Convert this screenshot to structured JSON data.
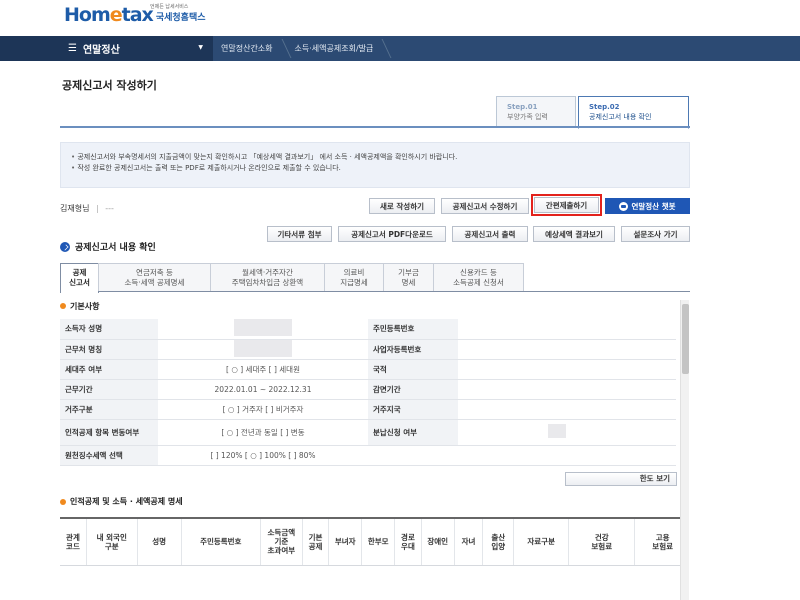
{
  "header": {
    "logo_small": "언제든 납세서비스",
    "logo_home": "Hom",
    "logo_e": "e",
    "logo_tax": "tax",
    "logo_agency": "국세청홈택스"
  },
  "nav": {
    "menu_label": "연말정산",
    "breadcrumbs": [
      "연말정산간소화",
      "소득·세액공제조회/발급"
    ]
  },
  "page": {
    "title": "공제신고서 작성하기"
  },
  "steps": [
    {
      "num": "Step.01",
      "label": "부양가족 입력"
    },
    {
      "num": "Step.02",
      "label": "공제신고서 내용 확인"
    }
  ],
  "notice": [
    "공제신고서와 부속명세서의 지출금액이 맞는지 확인하시고 「예상세액 결과보기」 에서 소득 · 세액공제액을 확인하시기 바랍니다.",
    "작성 완료한 공제신고서는 출력 또는 PDF로 제출하시거나 온라인으로 제출할 수 있습니다."
  ],
  "user": {
    "name": "김재형님",
    "sep": "|",
    "dashes": "---"
  },
  "buttons": {
    "new": "새로 작성하기",
    "edit": "공제신고서 수정하기",
    "submit": "간편제출하기",
    "chatbot": "연말정산 챗봇",
    "attach": "기타서류 첨부",
    "pdf": "공제신고서 PDF다운로드",
    "print": "공제신고서 출력",
    "result": "예상세액 결과보기",
    "survey": "설문조사 가기",
    "detail": "한도 보기"
  },
  "section": {
    "title": "공제신고서 내용 확인"
  },
  "tabs": [
    {
      "l1": "공제",
      "l2": "신고서"
    },
    {
      "l1": "연금저축 등",
      "l2": "소득·세액 공제명세"
    },
    {
      "l1": "월세액·거주자간",
      "l2": "주택임차차입금 상환액"
    },
    {
      "l1": "의료비",
      "l2": "지급명세"
    },
    {
      "l1": "기부금",
      "l2": "명세"
    },
    {
      "l1": "신용카드 등",
      "l2": "소득공제 신청서"
    }
  ],
  "basic": {
    "title": "기본사항",
    "rows": [
      {
        "k": "소득자 성명",
        "v": "",
        "k2": "주민등록번호",
        "v2": ""
      },
      {
        "k": "근무처 명칭",
        "v": "",
        "k2": "사업자등록번호",
        "v2": ""
      },
      {
        "k": "세대주 여부",
        "v": "[ ○ ] 세대주  [    ] 세대원",
        "k2": "국적",
        "v2": ""
      },
      {
        "k": "근무기간",
        "v": "2022.01.01 ~ 2022.12.31",
        "k2": "감면기간",
        "v2": ""
      },
      {
        "k": "거주구분",
        "v": "[ ○ ] 거주자  [    ] 비거주자",
        "k2": "거주지국",
        "v2": ""
      },
      {
        "k": "인적공제 항목 변동여부",
        "v": "[ ○ ] 전년과 동일  [    ] 변동",
        "k2": "분납신청 여부",
        "v2": ""
      },
      {
        "k": "원천징수세액 선택",
        "v": "[    ] 120%  [ ○ ] 100%  [    ] 80%",
        "k2": "",
        "v2": ""
      }
    ]
  },
  "deduction": {
    "title": "인적공제 및 소득 · 세액공제 명세",
    "headers": [
      "관계\n코드",
      "내 외국인\n구분",
      "성명",
      "주민등록번호",
      "소득금액\n기준\n초과여부",
      "기본\n공제",
      "부녀자",
      "한부모",
      "경로\n우대",
      "장애인",
      "자녀",
      "출산\n입양",
      "자료구분",
      "건강\n보험료",
      "고용\n보험료"
    ]
  }
}
